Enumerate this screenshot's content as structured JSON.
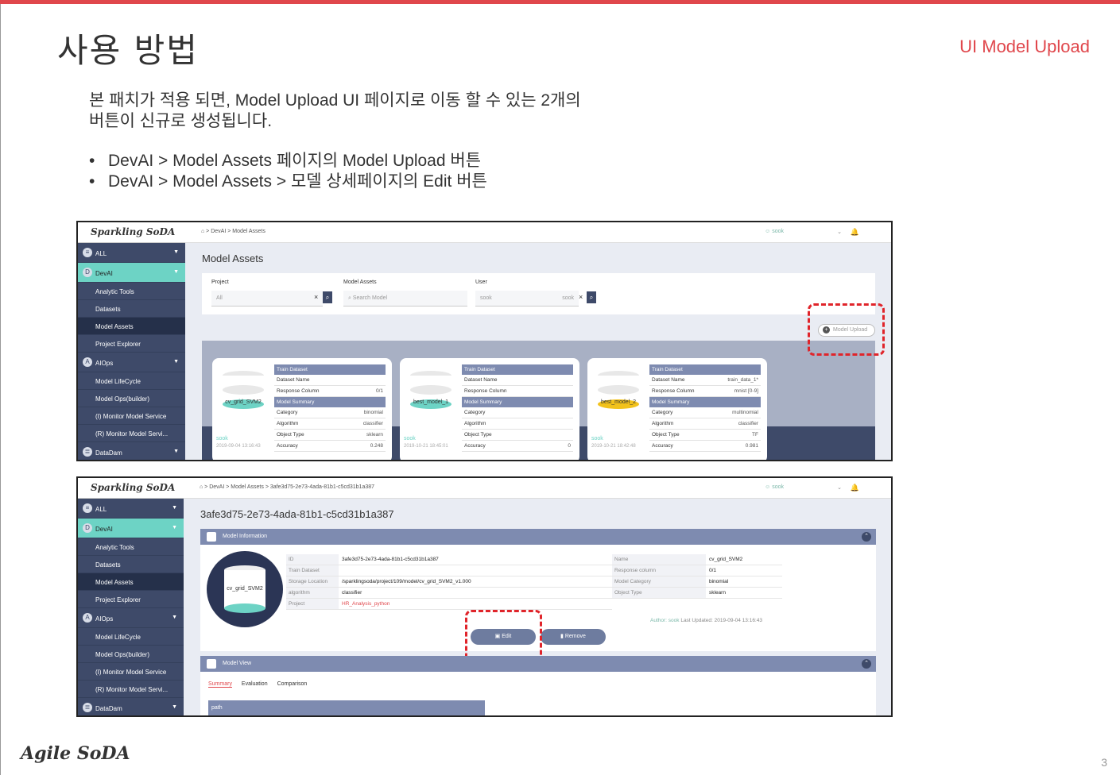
{
  "slide": {
    "title": "사용 방법",
    "section": "UI Model Upload",
    "desc": "본 패치가 적용 되면, Model Upload UI 페이지로 이동 할 수 있는 2개의 버튼이 신규로 생성됩니다.",
    "bullets": [
      "DevAI > Model Assets 페이지의 Model Upload 버튼",
      "DevAI > Model Assets > 모델 상세페이지의 Edit 버튼"
    ],
    "footer_logo": "Agile SoDA",
    "page_number": "3"
  },
  "app": {
    "logo": "Sparkling SoDA",
    "sidebar": {
      "all": "ALL",
      "devai": "DevAI",
      "devai_items": [
        "Analytic Tools",
        "Datasets",
        "Model Assets",
        "Project Explorer"
      ],
      "aiops": "AIOps",
      "aiops_items": [
        "Model LifeCycle",
        "Model Ops(builder)",
        "(I) Monitor Model Service",
        "(R) Monitor Model Servi..."
      ],
      "datadam": "DataDam"
    },
    "user": "sook"
  },
  "screen1": {
    "breadcrumb": "⌂  >  DevAI  >  Model Assets",
    "title": "Model Assets",
    "filters": {
      "project_label": "Project",
      "project_value": "All",
      "model_label": "Model Assets",
      "model_placeholder": "Search Model",
      "user_label": "User",
      "user_value": "sook",
      "user_value2": "sook"
    },
    "upload_button": "Model Upload",
    "cards": [
      {
        "name": "cv_grid_SVM2",
        "user": "sook",
        "date": "2019-09-04 13:16:43",
        "color": "#6dd3c5",
        "rows": [
          [
            "Train Dataset",
            ""
          ],
          [
            "Dataset Name",
            ""
          ],
          [
            "Response Column",
            "0/1"
          ],
          [
            "Model Summary",
            ""
          ],
          [
            "Category",
            "binomial"
          ],
          [
            "Algorithm",
            "classifier"
          ],
          [
            "Object Type",
            "sklearn"
          ],
          [
            "Accuracy",
            "0.248"
          ]
        ]
      },
      {
        "name": "best_model_1",
        "user": "sook",
        "date": "2019-10-21 18:45:01",
        "color": "#6dd3c5",
        "rows": [
          [
            "Train Dataset",
            ""
          ],
          [
            "Dataset Name",
            ""
          ],
          [
            "Response Column",
            ""
          ],
          [
            "Model Summary",
            ""
          ],
          [
            "Category",
            ""
          ],
          [
            "Algorithm",
            ""
          ],
          [
            "Object Type",
            ""
          ],
          [
            "Accuracy",
            "0"
          ]
        ]
      },
      {
        "name": "best_model_2",
        "user": "sook",
        "date": "2019-10-21 18:42:48",
        "color": "#f2c21b",
        "rows": [
          [
            "Train Dataset",
            ""
          ],
          [
            "Dataset Name",
            "train_data_1*"
          ],
          [
            "Response Column",
            "mnist [0-9]"
          ],
          [
            "Model Summary",
            ""
          ],
          [
            "Category",
            "multinomial"
          ],
          [
            "Algorithm",
            "classifier"
          ],
          [
            "Object Type",
            "TF"
          ],
          [
            "Accuracy",
            "0.981"
          ]
        ]
      }
    ]
  },
  "screen2": {
    "breadcrumb": "⌂  >  DevAI  >  Model Assets  >  3afe3d75-2e73-4ada-81b1-c5cd31b1a387",
    "title": "3afe3d75-2e73-4ada-81b1-c5cd31b1a387",
    "info_header": "Model Information",
    "model_name": "cv_grid_SVM2",
    "left_rows": [
      [
        "ID",
        "3afe3d75-2e73-4ada-81b1-c5cd31b1a387"
      ],
      [
        "Train Dataset",
        ""
      ],
      [
        "Storage Location",
        "/sparklingsoda/project/109/model/cv_grid_SVM2_v1.000"
      ],
      [
        "algorithm",
        "classifier"
      ],
      [
        "Project",
        "HR_Analysis_python"
      ]
    ],
    "right_rows": [
      [
        "Name",
        "cv_grid_SVM2"
      ],
      [
        "Response column",
        "0/1"
      ],
      [
        "Model Category",
        "binomial"
      ],
      [
        "Object Type",
        "sklearn"
      ]
    ],
    "author_label": "Author:",
    "author": "sook",
    "last_updated": "Last Updated: 2019-09-04 13:16:43",
    "edit_button": "Edit",
    "remove_button": "Remove",
    "view_header": "Model View",
    "tabs": [
      "Summary",
      "Evaluation",
      "Comparison"
    ],
    "path_label": "path"
  },
  "colors": {
    "accent": "#e0474c",
    "sidebar": "#3e4a69",
    "teal": "#6dd3c5",
    "yellow": "#f2c21b"
  }
}
